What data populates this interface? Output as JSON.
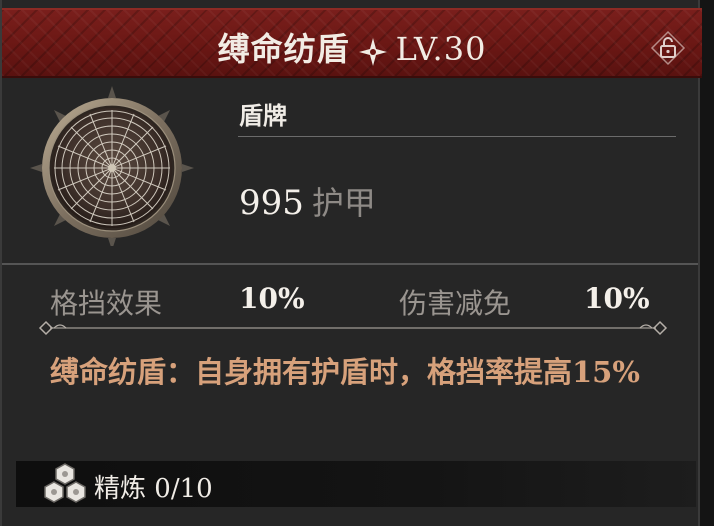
{
  "item": {
    "name": "缚命纺盾",
    "level": "LV.30",
    "type": "盾牌",
    "armor_value": "995",
    "armor_unit": "护甲"
  },
  "stats": [
    {
      "label": "格挡效果",
      "value": "10%"
    },
    {
      "label": "伤害减免",
      "value": "10%"
    }
  ],
  "effect_text": "缚命纺盾：自身拥有护盾时，格挡率提高15%",
  "refine": {
    "label": "精炼",
    "value": "0/10"
  },
  "icons": {
    "title_star": "four-point-star-icon",
    "lock": "padlock-icon",
    "item": "spiderweb-shield-icon",
    "refine": "hexagon-cluster-icon"
  },
  "colors": {
    "title_bar": "#6a1714",
    "effect_text": "#d7a17b",
    "stat_label": "#9a9590",
    "panel_bg": "#262626"
  }
}
